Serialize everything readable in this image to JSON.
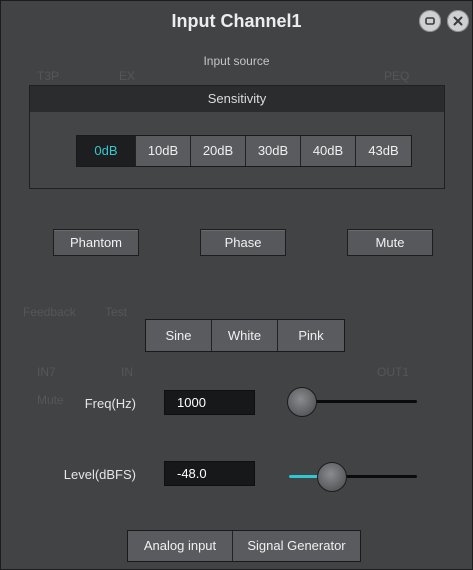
{
  "window": {
    "title": "Input Channel1"
  },
  "subtitle": "Input source",
  "sensitivity": {
    "header": "Sensitivity",
    "options": [
      "0dB",
      "10dB",
      "20dB",
      "30dB",
      "40dB",
      "43dB"
    ],
    "selected": "0dB"
  },
  "toggles": {
    "phantom": "Phantom",
    "phase": "Phase",
    "mute": "Mute"
  },
  "waveforms": {
    "options": [
      "Sine",
      "White",
      "Pink"
    ]
  },
  "freq": {
    "label": "Freq(Hz)",
    "value": "1000",
    "slider_level": 0.05
  },
  "level": {
    "label": "Level(dBFS)",
    "value": "-48.0",
    "slider_level": 0.33
  },
  "source_tabs": {
    "options": [
      "Analog input",
      "Signal Generator"
    ]
  },
  "colors": {
    "accent": "#2fc6d6",
    "panel": "#424345",
    "button": "#57585b",
    "selected_text": "#36c8d0"
  },
  "icons": {
    "restore": "restore-icon",
    "close": "close-icon"
  }
}
